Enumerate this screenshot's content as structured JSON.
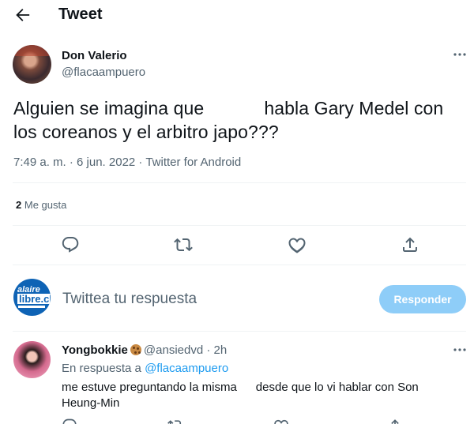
{
  "header": {
    "title": "Tweet",
    "back_icon": "arrow-left-icon"
  },
  "tweet": {
    "author": {
      "display_name": "Don Valerio",
      "handle": "@flacaampuero"
    },
    "text_part1": "Alguien se imagina que",
    "text_part2": "habla Gary Medel con",
    "text_line2": "los coreanos y el arbitro japo???",
    "meta": "7:49 a. m. · 6 jun. 2022 · Twitter for Android",
    "likes_count": "2",
    "likes_label": "Me gusta",
    "actions": [
      "reply-icon",
      "retweet-icon",
      "like-icon",
      "share-icon"
    ]
  },
  "composer": {
    "avatar_text_top": "alaire",
    "avatar_text_bottom": "libre.cl",
    "placeholder": "Twittea tu respuesta",
    "button_label": "Responder"
  },
  "reply": {
    "display_name": "Yongbokkie",
    "handle": "@ansiedvd",
    "dot": "·",
    "time": "2h",
    "replying_prefix": "En respuesta a",
    "replying_to": "@flacaampuero",
    "text_part1": "me estuve preguntando la misma",
    "text_part2": "desde que lo vi hablar con Son",
    "text_line2": "Heung-Min"
  },
  "colors": {
    "accent": "#1d9bf0",
    "button_disabled": "#8ecdf8",
    "text_secondary": "#536471"
  }
}
